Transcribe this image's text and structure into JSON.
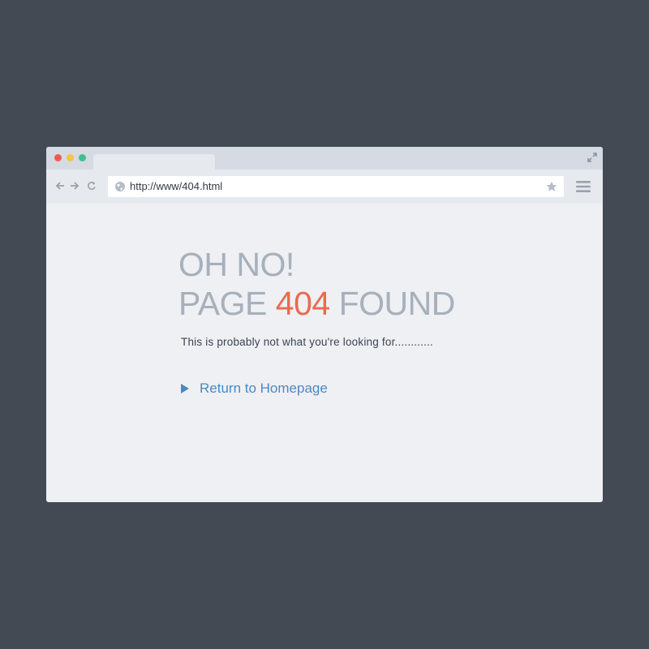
{
  "browser": {
    "address_bar": {
      "url": "http://www/404.html"
    }
  },
  "page": {
    "heading_line1": "OH NO!",
    "heading_line2_prefix": "PAGE ",
    "error_code": "404",
    "heading_line2_suffix": " FOUND",
    "subtitle": "This is probably not what you're looking for............",
    "return_link_label": "Return to Homepage"
  },
  "colors": {
    "background": "#434a54",
    "window": "#eef0f4",
    "heading": "#a7b0bb",
    "error_code": "#ea6a50",
    "link": "#4a89c8",
    "close_dot": "#ef5b4b",
    "minimize_dot": "#f5c342",
    "maximize_dot": "#3ebf8f"
  },
  "icons": [
    "expand-icon",
    "back-arrow-icon",
    "forward-arrow-icon",
    "reload-icon",
    "globe-icon",
    "star-icon",
    "hamburger-menu-icon",
    "play-triangle-icon"
  ]
}
